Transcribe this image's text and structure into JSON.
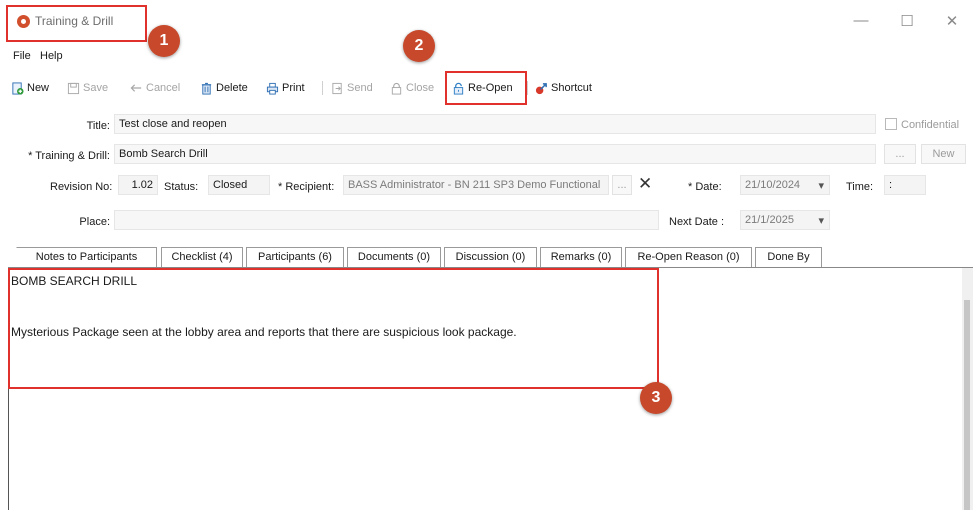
{
  "window": {
    "title": "Training & Drill",
    "minimize_glyph": "—",
    "maximize_glyph": "☐",
    "close_glyph": "✕"
  },
  "menu": {
    "file": "File",
    "help": "Help"
  },
  "toolbar": {
    "new": "New",
    "save": "Save",
    "cancel": "Cancel",
    "delete": "Delete",
    "print": "Print",
    "send": "Send",
    "close": "Close",
    "reopen": "Re-Open",
    "shortcut": "Shortcut"
  },
  "form": {
    "title_label": "Title:",
    "title_value": "Test close and reopen",
    "confidential_label": "Confidential",
    "training_label": "* Training & Drill:",
    "training_value": "Bomb Search Drill",
    "ellipsis": "...",
    "new_button": "New",
    "revision_label": "Revision No:",
    "revision_value": "1.02",
    "status_label": "Status:",
    "status_value": "Closed",
    "recipient_label": "* Recipient:",
    "recipient_value": "BASS Administrator - BN 211 SP3 Demo Functional",
    "clear_glyph": "✕",
    "date_label": "* Date:",
    "date_value": "21/10/2024",
    "time_label": "Time:",
    "time_value": ":",
    "place_label": "Place:",
    "place_value": "",
    "next_date_label": "Next Date :",
    "next_date_value": "21/1/2025",
    "dropdown_glyph": "▾"
  },
  "tabs": [
    {
      "label": "Notes to Participants"
    },
    {
      "label": "Checklist (4)"
    },
    {
      "label": "Participants (6)"
    },
    {
      "label": "Documents (0)"
    },
    {
      "label": "Discussion (0)"
    },
    {
      "label": "Remarks (0)"
    },
    {
      "label": "Re-Open Reason (0)"
    },
    {
      "label": "Done By"
    }
  ],
  "notes": {
    "line1": "BOMB SEARCH DRILL",
    "line2": "Mysterious Package seen at the lobby area and reports that there are suspicious look package."
  },
  "annotations": {
    "badge1": "1",
    "badge2": "2",
    "badge3": "3"
  },
  "colors": {
    "highlight": "#e0312d",
    "badge": "#c7482a",
    "app_icon": "#d24f2d",
    "reopen_icon": "#2f7fc4"
  }
}
